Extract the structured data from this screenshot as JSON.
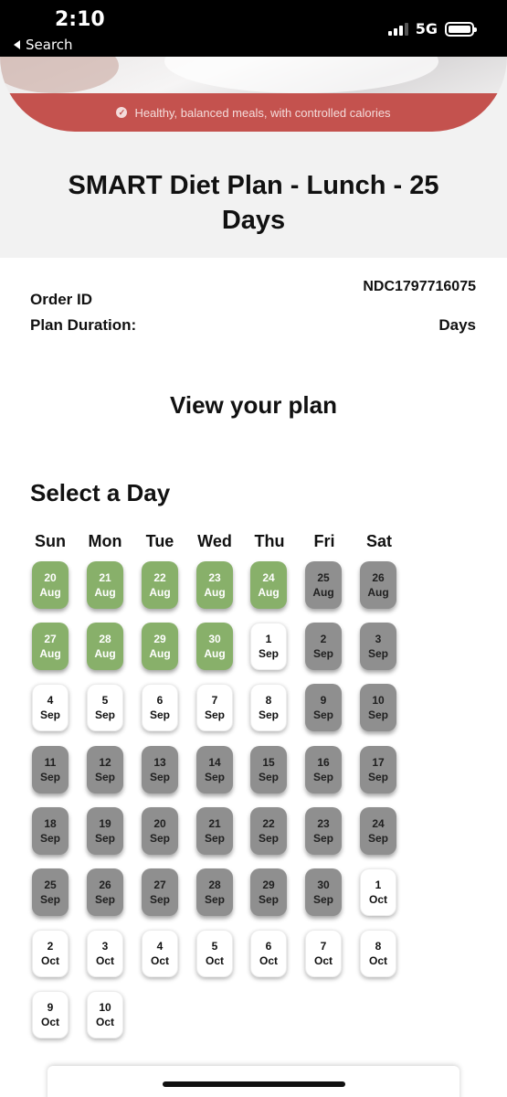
{
  "status": {
    "time": "2:10",
    "back_label": "Search",
    "network": "5G"
  },
  "banner": {
    "tagline": "Healthy, balanced meals, with controlled calories"
  },
  "plan": {
    "title": "SMART Diet Plan - Lunch - 25 Days"
  },
  "order": {
    "id_label": "Order ID",
    "id_value": "NDC1797716075",
    "duration_label": "Plan Duration:",
    "duration_value": "Days"
  },
  "view_plan": "View your plan",
  "select_day": "Select a Day",
  "weekdays": [
    "Sun",
    "Mon",
    "Tue",
    "Wed",
    "Thu",
    "Fri",
    "Sat"
  ],
  "colors": {
    "selected": "#88b06a",
    "unavailable": "#8f8f8f",
    "available": "#ffffff",
    "banner_strip": "#c4524e"
  },
  "days": [
    {
      "d": "20",
      "m": "Aug",
      "s": "g"
    },
    {
      "d": "21",
      "m": "Aug",
      "s": "g"
    },
    {
      "d": "22",
      "m": "Aug",
      "s": "g"
    },
    {
      "d": "23",
      "m": "Aug",
      "s": "g"
    },
    {
      "d": "24",
      "m": "Aug",
      "s": "g"
    },
    {
      "d": "25",
      "m": "Aug",
      "s": "x"
    },
    {
      "d": "26",
      "m": "Aug",
      "s": "x"
    },
    {
      "d": "27",
      "m": "Aug",
      "s": "g"
    },
    {
      "d": "28",
      "m": "Aug",
      "s": "g"
    },
    {
      "d": "29",
      "m": "Aug",
      "s": "g"
    },
    {
      "d": "30",
      "m": "Aug",
      "s": "g"
    },
    {
      "d": "1",
      "m": "Sep",
      "s": "w"
    },
    {
      "d": "2",
      "m": "Sep",
      "s": "x"
    },
    {
      "d": "3",
      "m": "Sep",
      "s": "x"
    },
    {
      "d": "4",
      "m": "Sep",
      "s": "w"
    },
    {
      "d": "5",
      "m": "Sep",
      "s": "w"
    },
    {
      "d": "6",
      "m": "Sep",
      "s": "w"
    },
    {
      "d": "7",
      "m": "Sep",
      "s": "w"
    },
    {
      "d": "8",
      "m": "Sep",
      "s": "w"
    },
    {
      "d": "9",
      "m": "Sep",
      "s": "x"
    },
    {
      "d": "10",
      "m": "Sep",
      "s": "x"
    },
    {
      "d": "11",
      "m": "Sep",
      "s": "x"
    },
    {
      "d": "12",
      "m": "Sep",
      "s": "x"
    },
    {
      "d": "13",
      "m": "Sep",
      "s": "x"
    },
    {
      "d": "14",
      "m": "Sep",
      "s": "x"
    },
    {
      "d": "15",
      "m": "Sep",
      "s": "x"
    },
    {
      "d": "16",
      "m": "Sep",
      "s": "x"
    },
    {
      "d": "17",
      "m": "Sep",
      "s": "x"
    },
    {
      "d": "18",
      "m": "Sep",
      "s": "x"
    },
    {
      "d": "19",
      "m": "Sep",
      "s": "x"
    },
    {
      "d": "20",
      "m": "Sep",
      "s": "x"
    },
    {
      "d": "21",
      "m": "Sep",
      "s": "x"
    },
    {
      "d": "22",
      "m": "Sep",
      "s": "x"
    },
    {
      "d": "23",
      "m": "Sep",
      "s": "x"
    },
    {
      "d": "24",
      "m": "Sep",
      "s": "x"
    },
    {
      "d": "25",
      "m": "Sep",
      "s": "x"
    },
    {
      "d": "26",
      "m": "Sep",
      "s": "x"
    },
    {
      "d": "27",
      "m": "Sep",
      "s": "x"
    },
    {
      "d": "28",
      "m": "Sep",
      "s": "x"
    },
    {
      "d": "29",
      "m": "Sep",
      "s": "x"
    },
    {
      "d": "30",
      "m": "Sep",
      "s": "x"
    },
    {
      "d": "1",
      "m": "Oct",
      "s": "w"
    },
    {
      "d": "2",
      "m": "Oct",
      "s": "w"
    },
    {
      "d": "3",
      "m": "Oct",
      "s": "w"
    },
    {
      "d": "4",
      "m": "Oct",
      "s": "w"
    },
    {
      "d": "5",
      "m": "Oct",
      "s": "w"
    },
    {
      "d": "6",
      "m": "Oct",
      "s": "w"
    },
    {
      "d": "7",
      "m": "Oct",
      "s": "w"
    },
    {
      "d": "8",
      "m": "Oct",
      "s": "w"
    },
    {
      "d": "9",
      "m": "Oct",
      "s": "w"
    },
    {
      "d": "10",
      "m": "Oct",
      "s": "w"
    }
  ]
}
